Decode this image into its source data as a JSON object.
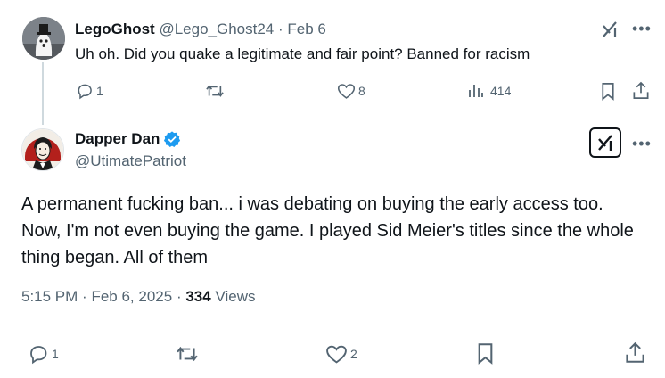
{
  "reply": {
    "author_name": "LegoGhost",
    "handle": "@Lego_Ghost24",
    "separator": "·",
    "date": "Feb 6",
    "text": "Uh oh. Did you quake a legitimate and fair point? Banned for racism",
    "replies": "1",
    "likes": "8",
    "views": "414"
  },
  "main": {
    "author_name": "Dapper Dan",
    "handle": "@UtimatePatriot",
    "text": "A permanent fucking ban... i was debating on buying the early access too. Now, I'm not even buying the game.  I played Sid Meier's titles since the whole thing began. All of them",
    "time": "5:15 PM",
    "sep1": "·",
    "date": "Feb 6, 2025",
    "sep2": "·",
    "views": "334",
    "views_label": "Views",
    "replies": "1",
    "likes": "2"
  },
  "colors": {
    "text": "#0f1419",
    "muted": "#536471",
    "verified": "#1d9bf0",
    "divider": "#cfd9de"
  },
  "icons": [
    "reply-icon",
    "repost-icon",
    "like-icon",
    "views-icon",
    "bookmark-icon",
    "share-icon",
    "grok-icon",
    "more-icon",
    "verified-badge-icon"
  ]
}
